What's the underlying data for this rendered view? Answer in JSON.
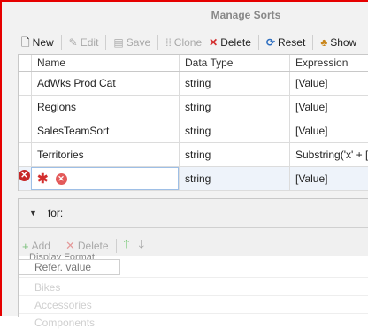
{
  "dialog": {
    "title": "Manage Sorts"
  },
  "toolbar": {
    "new": "New",
    "edit": "Edit",
    "save": "Save",
    "clone": "Clone",
    "delete": "Delete",
    "reset": "Reset",
    "show": "Show"
  },
  "grid": {
    "headers": [
      "Name",
      "Data Type",
      "Expression"
    ],
    "rows": [
      {
        "name": "AdWks Prod Cat",
        "type": "string",
        "expr": "[Value]"
      },
      {
        "name": "Regions",
        "type": "string",
        "expr": "[Value]"
      },
      {
        "name": "SalesTeamSort",
        "type": "string",
        "expr": "[Value]"
      },
      {
        "name": "Territories",
        "type": "string",
        "expr": "Substring('x' + [Valu"
      }
    ],
    "new_row": {
      "type": "string",
      "expr": "[Value]"
    }
  },
  "lower": {
    "for_label": "for:",
    "add": "Add",
    "delete": "Delete",
    "display_format": "Display Format:",
    "refer_value": "Refer. value",
    "items": [
      "Bikes",
      "Accessories",
      "Components"
    ]
  },
  "colors": {
    "frame": "#e60000",
    "error": "#c62828",
    "delete": "#d32f2f",
    "reset": "#2f6fc0",
    "up": "#5bbf5b"
  },
  "icons": [
    "new-icon",
    "edit-icon",
    "save-icon",
    "clone-icon",
    "delete-icon",
    "reset-icon",
    "show-icon",
    "error-icon",
    "required-icon",
    "remove-icon",
    "collapse-icon",
    "add-icon",
    "move-up-icon",
    "move-down-icon"
  ]
}
